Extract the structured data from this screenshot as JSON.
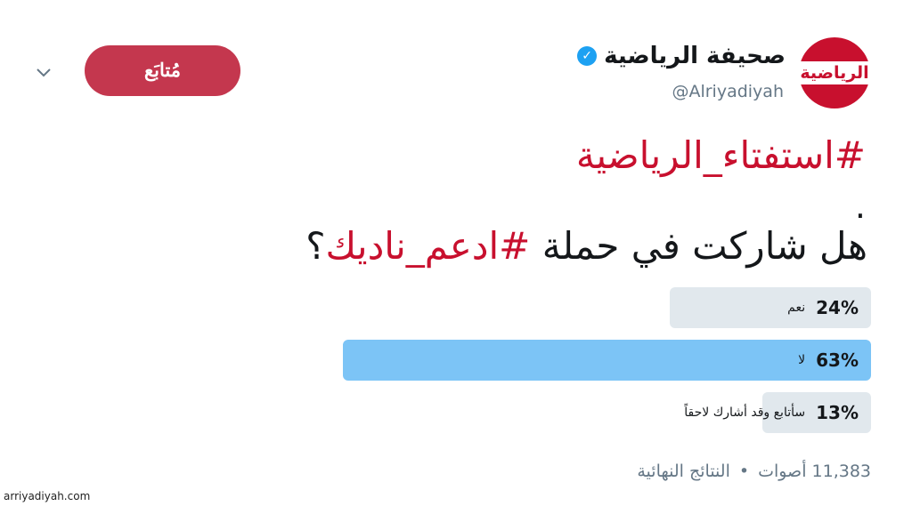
{
  "account": {
    "avatar_text": "الرياضية",
    "name": "صحيفة الرياضية",
    "handle": "@Alriyadiyah",
    "verified_icon": "verified-badge-icon",
    "follow_label": "مُتابَع"
  },
  "tweet": {
    "hashtag_line": "#استفتاء_الرياضية",
    "dot": ".",
    "question_prefix": "هل شاركت في حملة ",
    "question_tag": "#ادعم_ناديك",
    "question_suffix": "؟"
  },
  "poll": {
    "options": [
      {
        "label": "نعم",
        "percent_text": "24%",
        "percent": 24,
        "winner": false
      },
      {
        "label": "لا",
        "percent_text": "63%",
        "percent": 63,
        "winner": true
      },
      {
        "label": "سأتابع وقد أشارك لاحقاً",
        "percent_text": "13%",
        "percent": 13,
        "winner": false
      }
    ],
    "votes": "11,383 أصوات",
    "separator": "•",
    "status": "النتائج النهائية"
  },
  "watermark": "arriyadiyah.com",
  "colors": {
    "accent": "#c8102e",
    "follow_bg": "#c4374e",
    "winner_bar": "#7cc4f6",
    "bar": "#e1e8ed"
  }
}
